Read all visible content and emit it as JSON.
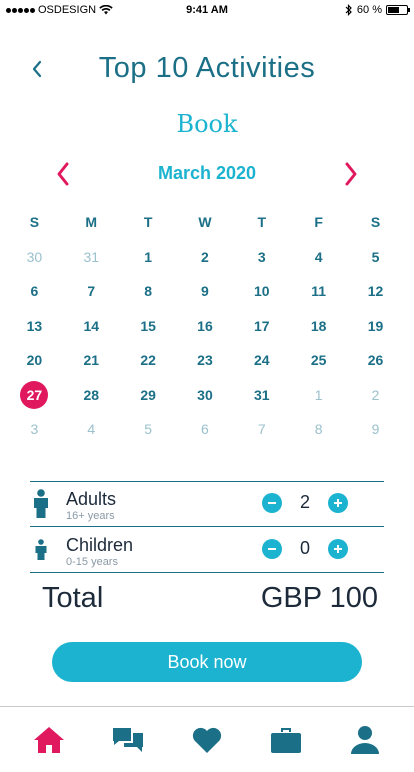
{
  "status_bar": {
    "carrier": "OSDESIGN",
    "time": "9:41 AM",
    "battery": "60 %",
    "battery_level": 0.6
  },
  "header": {
    "title": "Top 10 Activities",
    "back_icon": "chevron-left-icon"
  },
  "book_heading": "Book",
  "calendar": {
    "month_label": "March 2020",
    "weekdays": [
      "S",
      "M",
      "T",
      "W",
      "T",
      "F",
      "S"
    ],
    "selected_day": "27",
    "weeks": [
      [
        {
          "d": "30",
          "m": true
        },
        {
          "d": "31",
          "m": true
        },
        {
          "d": "1"
        },
        {
          "d": "2"
        },
        {
          "d": "3"
        },
        {
          "d": "4"
        },
        {
          "d": "5"
        }
      ],
      [
        {
          "d": "6"
        },
        {
          "d": "7"
        },
        {
          "d": "8"
        },
        {
          "d": "9"
        },
        {
          "d": "10"
        },
        {
          "d": "11"
        },
        {
          "d": "12"
        }
      ],
      [
        {
          "d": "13"
        },
        {
          "d": "14"
        },
        {
          "d": "15"
        },
        {
          "d": "16"
        },
        {
          "d": "17"
        },
        {
          "d": "18"
        },
        {
          "d": "19"
        }
      ],
      [
        {
          "d": "20"
        },
        {
          "d": "21"
        },
        {
          "d": "22"
        },
        {
          "d": "23"
        },
        {
          "d": "24"
        },
        {
          "d": "25"
        },
        {
          "d": "26"
        }
      ],
      [
        {
          "d": "27",
          "s": true
        },
        {
          "d": "28"
        },
        {
          "d": "29"
        },
        {
          "d": "30"
        },
        {
          "d": "31"
        },
        {
          "d": "1",
          "m": true
        },
        {
          "d": "2",
          "m": true
        }
      ],
      [
        {
          "d": "3",
          "m": true
        },
        {
          "d": "4",
          "m": true
        },
        {
          "d": "5",
          "m": true
        },
        {
          "d": "6",
          "m": true
        },
        {
          "d": "7",
          "m": true
        },
        {
          "d": "8",
          "m": true
        },
        {
          "d": "9",
          "m": true
        }
      ]
    ]
  },
  "guests": {
    "adults": {
      "label": "Adults",
      "sub": "16+ years",
      "count": "2"
    },
    "children": {
      "label": "Children",
      "sub": "0-15 years",
      "count": "0"
    }
  },
  "total": {
    "label": "Total",
    "value": "GBP 100"
  },
  "book_button": "Book now",
  "tabs": [
    {
      "icon": "home-icon",
      "active": true
    },
    {
      "icon": "chat-icon",
      "active": false
    },
    {
      "icon": "heart-icon",
      "active": false
    },
    {
      "icon": "briefcase-icon",
      "active": false
    },
    {
      "icon": "user-icon",
      "active": false
    }
  ],
  "colors": {
    "primary": "#1b6f86",
    "accent": "#1bb3cf",
    "highlight": "#e0195e",
    "muted": "#9bc1cd"
  }
}
